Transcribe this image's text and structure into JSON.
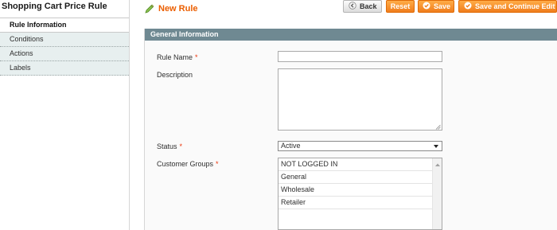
{
  "sidebar": {
    "title": "Shopping Cart Price Rule",
    "tabs": [
      {
        "label": "Rule Information",
        "active": true
      },
      {
        "label": "Conditions"
      },
      {
        "label": "Actions"
      },
      {
        "label": "Labels"
      }
    ]
  },
  "header": {
    "title": "New Rule",
    "title_icon": "pencil-icon"
  },
  "toolbar": {
    "back_label": "Back",
    "reset_label": "Reset",
    "save_label": "Save",
    "save_continue_label": "Save and Continue Edit"
  },
  "form": {
    "section_title": "General Information",
    "rule_name": {
      "label": "Rule Name",
      "required": "*",
      "value": ""
    },
    "description": {
      "label": "Description",
      "value": ""
    },
    "status": {
      "label": "Status",
      "required": "*",
      "selected": "Active"
    },
    "customer_groups": {
      "label": "Customer Groups",
      "required": "*",
      "options": [
        "NOT LOGGED IN",
        "General",
        "Wholesale",
        "Retailer"
      ]
    }
  },
  "colors": {
    "accent_orange": "#eb5e00",
    "section_header": "#6f8992",
    "required": "#eb340a",
    "tab_background": "#e7efef"
  }
}
